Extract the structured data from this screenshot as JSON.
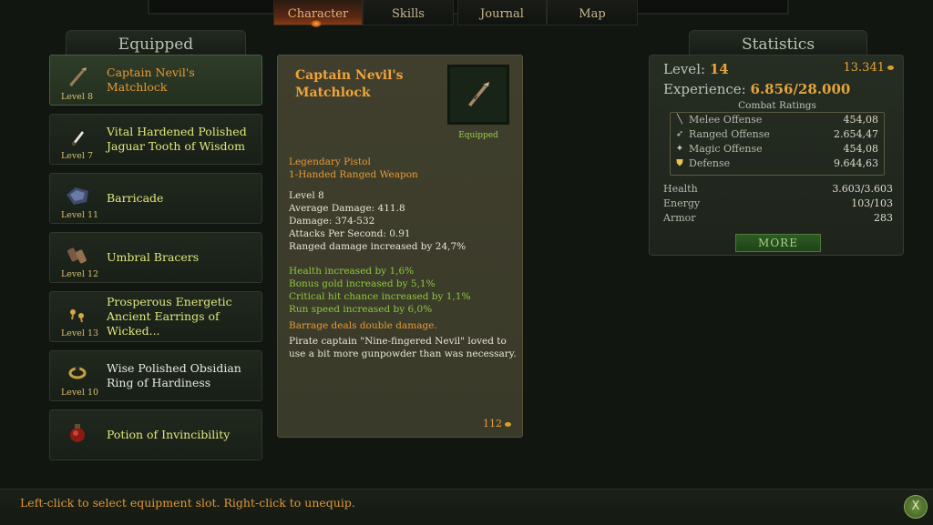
{
  "tabs": [
    {
      "label": "Character",
      "active": true
    },
    {
      "label": "Skills",
      "active": false
    },
    {
      "label": "Journal",
      "active": false
    },
    {
      "label": "Map",
      "active": false
    }
  ],
  "equipped": {
    "header": "Equipped",
    "items": [
      {
        "name_lines": [
          "Captain Nevil's Matchlock"
        ],
        "level": "Level 8",
        "icon": "matchlock-icon",
        "rarity_color": "#e79a32",
        "selected": true
      },
      {
        "name_lines": [
          "Vital Hardened Polished",
          "Jaguar Tooth of Wisdom"
        ],
        "level": "Level 7",
        "icon": "tooth-icon",
        "rarity_color": "#dfe87a",
        "selected": false
      },
      {
        "name_lines": [
          "Barricade"
        ],
        "level": "Level 11",
        "icon": "shield-icon",
        "rarity_color": "#dfe87a",
        "selected": false
      },
      {
        "name_lines": [
          "Umbral Bracers"
        ],
        "level": "Level 12",
        "icon": "bracers-icon",
        "rarity_color": "#dfe87a",
        "selected": false
      },
      {
        "name_lines": [
          "Prosperous Energetic",
          "Ancient Earrings of Wicked..."
        ],
        "level": "Level 13",
        "icon": "earrings-icon",
        "rarity_color": "#dfe87a",
        "selected": false
      },
      {
        "name_lines": [
          "Wise Polished Obsidian",
          "Ring of Hardiness"
        ],
        "level": "Level 10",
        "icon": "ring-icon",
        "rarity_color": "#e8e8e0",
        "selected": false
      },
      {
        "name_lines": [
          "Potion of Invincibility"
        ],
        "level": "",
        "icon": "potion-icon",
        "rarity_color": "#dfe87a",
        "selected": false
      }
    ]
  },
  "detail": {
    "title": "Captain Nevil's Matchlock",
    "equipped_label": "Equipped",
    "type_lines": [
      "Legendary Pistol",
      "1-Handed Ranged Weapon"
    ],
    "base_stats": [
      "Level 8",
      "Average Damage: 411.8",
      "Damage: 374-532",
      "Attacks Per Second: 0.91",
      "Ranged damage increased by 24,7%"
    ],
    "bonus_stats": [
      "Health increased by 1,6%",
      "Bonus gold increased by 5,1%",
      "Critical hit chance increased by 1,1%",
      "Run speed increased by 6,0%"
    ],
    "special": "Barrage deals double damage.",
    "flavor_lines": [
      "Pirate captain \"Nine-fingered Nevil\" loved to",
      "use a bit more gunpowder than was necessary."
    ],
    "price": "112"
  },
  "statistics": {
    "header": "Statistics",
    "level_label": "Level:",
    "level_value": "14",
    "gold": "13.341",
    "experience_label": "Experience:",
    "experience_value": "6.856/28.000",
    "combat_title": "Combat Ratings",
    "combat": [
      {
        "icon": "sword-icon",
        "label": "Melee Offense",
        "value": "454,08"
      },
      {
        "icon": "arrow-icon",
        "label": "Ranged Offense",
        "value": "2.654,47"
      },
      {
        "icon": "wand-icon",
        "label": "Magic Offense",
        "value": "454,08"
      },
      {
        "icon": "shield-icon",
        "label": "Defense",
        "value": "9.644,63"
      }
    ],
    "vitals": [
      {
        "label": "Health",
        "value": "3.603/3.603"
      },
      {
        "label": "Energy",
        "value": "103/103"
      },
      {
        "label": "Armor",
        "value": "283"
      }
    ],
    "more_label": "MORE"
  },
  "footer": {
    "hint": "Left-click to select equipment slot. Right-click to unequip.",
    "close_label": "X"
  }
}
